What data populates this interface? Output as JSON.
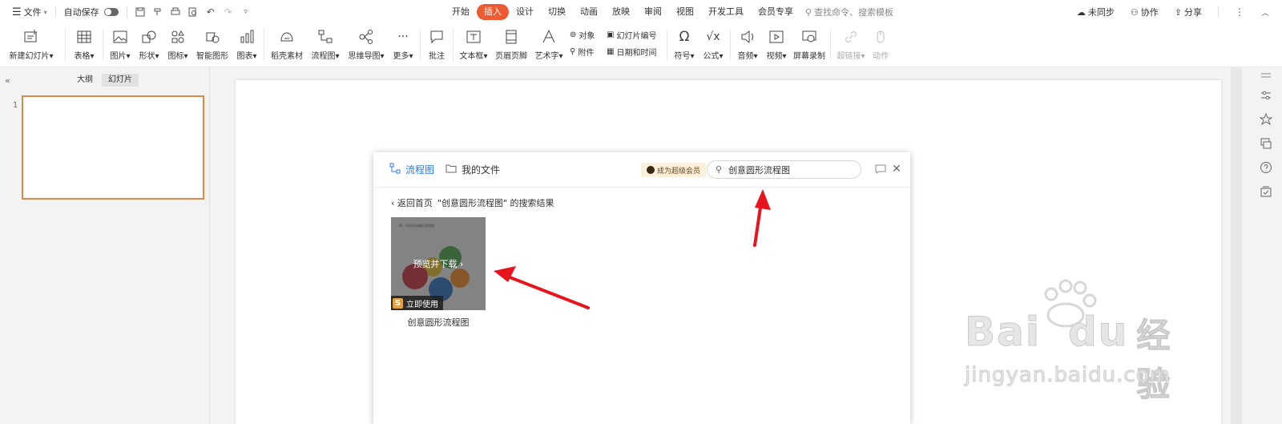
{
  "topbar": {
    "file_label": "文件",
    "autosave_label": "自动保存",
    "tabs": [
      {
        "label": "开始"
      },
      {
        "label": "插入",
        "active": true
      },
      {
        "label": "设计"
      },
      {
        "label": "切换"
      },
      {
        "label": "动画"
      },
      {
        "label": "放映"
      },
      {
        "label": "审阅"
      },
      {
        "label": "视图"
      },
      {
        "label": "开发工具"
      },
      {
        "label": "会员专享"
      }
    ],
    "search_placeholder": "查找命令、搜索模板",
    "sync_label": "未同步",
    "collab_label": "协作",
    "share_label": "分享"
  },
  "ribbon": {
    "new_slide": "新建幻灯片",
    "table": "表格",
    "picture": "图片",
    "shape": "形状",
    "icon": "图标",
    "smart_graphic": "智能图形",
    "chart": "图表",
    "shell_material": "稻壳素材",
    "flowchart": "流程图",
    "mindmap": "思维导图",
    "more": "更多",
    "comment": "批注",
    "textbox": "文本框",
    "header_footer": "页眉页脚",
    "wordart": "艺术字",
    "object": "对象",
    "attachment": "附件",
    "slide_number": "幻灯片编号",
    "date_time": "日期和时间",
    "symbol": "符号",
    "formula": "公式",
    "audio": "音频",
    "video": "视频",
    "screen_record": "屏幕录制",
    "hyperlink": "超链接",
    "action": "动作"
  },
  "left_panel": {
    "outline_tab": "大纲",
    "slides_tab": "幻灯片",
    "slide_number": "1"
  },
  "dialog": {
    "tab_flowchart": "流程图",
    "tab_myfiles": "我的文件",
    "vip_label": "成为超级会员",
    "search_value": "创意圆形流程图",
    "back_label": "返回首页",
    "result_text": "\"创意圆形流程图\" 的搜索结果",
    "card": {
      "preview_label": "预览并下载",
      "use_label": "立即使用",
      "name": "创意圆形流程图",
      "thumb_title": "四、不同方向圆形流程图"
    }
  },
  "watermark": {
    "brand": "Bai",
    "brand2": "du",
    "suffix": "经验",
    "url": "jingyan.baidu.com"
  },
  "colors": {
    "accent": "#ec5b32",
    "flowchart_blue": "#2b7be0",
    "arrow_red": "#e8141d",
    "thumb_border": "#d98a4a"
  }
}
